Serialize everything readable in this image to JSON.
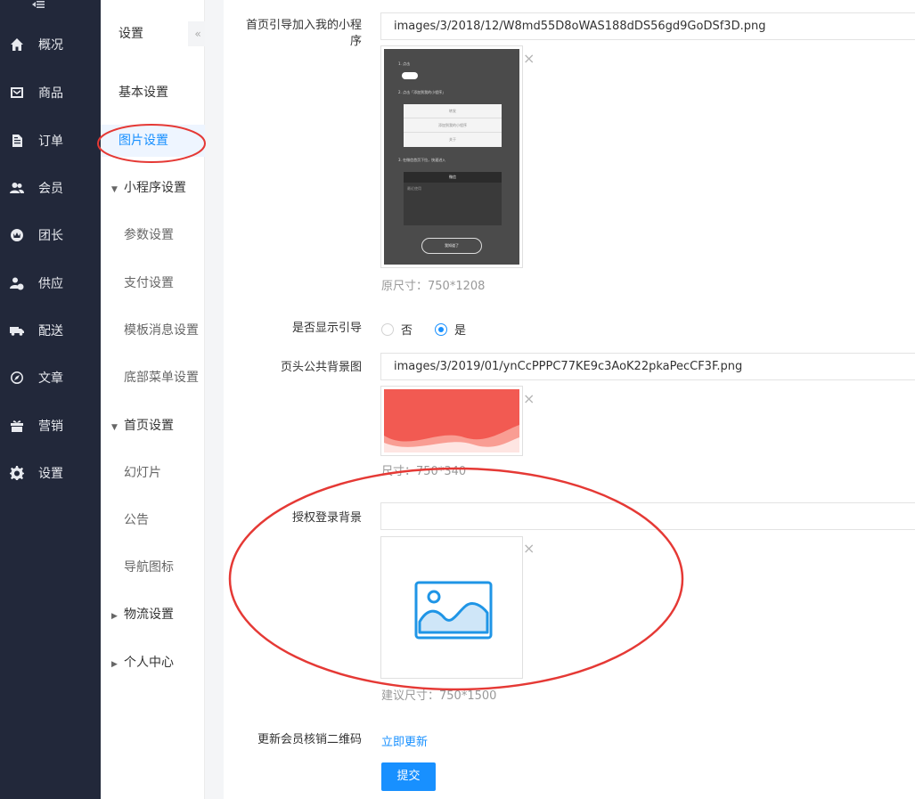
{
  "nav": {
    "items": [
      {
        "label": "概况",
        "icon": "home-icon"
      },
      {
        "label": "商品",
        "icon": "goods-icon"
      },
      {
        "label": "订单",
        "icon": "order-icon"
      },
      {
        "label": "会员",
        "icon": "members-icon"
      },
      {
        "label": "团长",
        "icon": "leader-icon"
      },
      {
        "label": "供应",
        "icon": "supplier-icon"
      },
      {
        "label": "配送",
        "icon": "truck-icon"
      },
      {
        "label": "文章",
        "icon": "compass-icon"
      },
      {
        "label": "营销",
        "icon": "gift-icon"
      },
      {
        "label": "设置",
        "icon": "gear-icon"
      }
    ]
  },
  "subnav": {
    "title": "设置",
    "collapse_glyph": "«",
    "items": [
      {
        "label": "基本设置"
      },
      {
        "label": "图片设置"
      },
      {
        "label": "小程序设置"
      },
      {
        "label": "参数设置"
      },
      {
        "label": "支付设置"
      },
      {
        "label": "模板消息设置"
      },
      {
        "label": "底部菜单设置"
      },
      {
        "label": "首页设置"
      },
      {
        "label": "幻灯片"
      },
      {
        "label": "公告"
      },
      {
        "label": "导航图标"
      },
      {
        "label": "物流设置"
      },
      {
        "label": "个人中心"
      }
    ]
  },
  "form": {
    "guide_label": "首页引导加入我的小程序",
    "guide_path": "images/3/2018/12/W8md55D8oWAS188dDS56gd9GoDSf3D.png",
    "guide_size": "原尺寸：750*1208",
    "guide_preview": {
      "step1": "1. 点击",
      "step2": "2. 点击「添加到我的小程序」",
      "menu_items": [
        "转发",
        "添加到我的小程序",
        "关于"
      ],
      "step3": "3. 在微信首页下拉，快速进入",
      "chat_title": "微信",
      "search_hint": "最近使用",
      "button": "我知道了"
    },
    "show_guide_label": "是否显示引导",
    "option_no": "否",
    "option_yes": "是",
    "show_guide_value": "是",
    "header_bg_label": "页头公共背景图",
    "header_bg_path": "images/3/2019/01/ynCcPPPC77KE9c3AoK22pkaPecCF3F.png",
    "header_bg_size": "尺寸：750*340",
    "login_bg_label": "授权登录背景",
    "login_bg_path": "",
    "login_bg_hint": "建议尺寸：750*1500",
    "qrcode_label": "更新会员核销二维码",
    "qrcode_link": "立即更新",
    "submit": "提交"
  },
  "colors": {
    "sidebar_bg": "#22283a",
    "accent": "#1890ff",
    "annotation": "#e53935",
    "header_banner": "#f25a52"
  }
}
